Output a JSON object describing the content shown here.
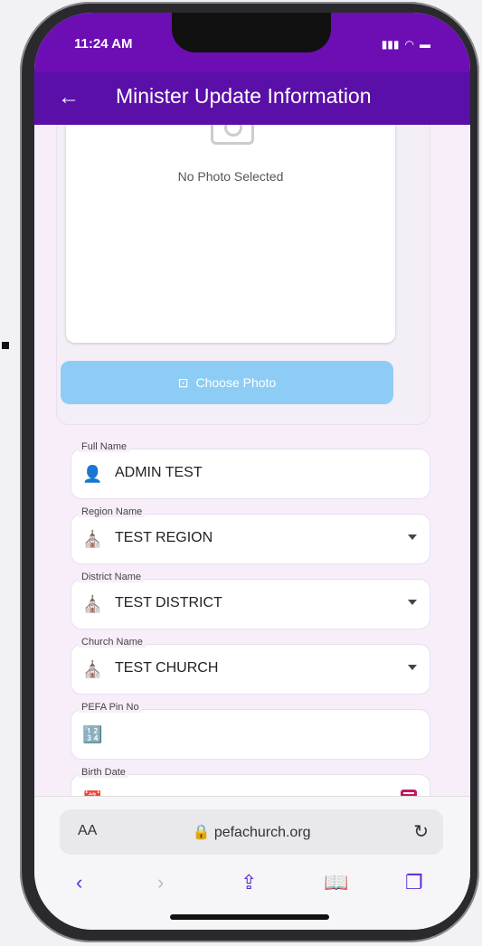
{
  "status": {
    "time": "11:24 AM",
    "signal_icon": "signal-icon",
    "wifi_icon": "wifi-icon",
    "battery_icon": "battery-icon"
  },
  "appbar": {
    "back_icon": "arrow-left-icon",
    "title": "Minister Update Information"
  },
  "photo": {
    "placeholder_text": "No Photo Selected",
    "choose_label": "Choose Photo"
  },
  "fields": {
    "full_name": {
      "label": "Full Name",
      "value": "ADMIN TEST",
      "icon": "person-icon"
    },
    "region": {
      "label": "Region Name",
      "value": "TEST REGION",
      "icon": "church-icon"
    },
    "district": {
      "label": "District Name",
      "value": "TEST DISTRICT",
      "icon": "church-icon"
    },
    "church": {
      "label": "Church Name",
      "value": "TEST CHURCH",
      "icon": "church-icon"
    },
    "pin": {
      "label": "PEFA Pin No",
      "value": "",
      "icon": "number-box-icon"
    },
    "birth": {
      "label": "Birth Date",
      "value": "",
      "icon": "calendar-icon"
    }
  },
  "browser": {
    "aa": "AA",
    "url": "pefachurch.org"
  },
  "colors": {
    "header": "#5a0fa8",
    "status": "#6d0eb5",
    "button": "#8dcdf5",
    "accent": "#c2185b"
  }
}
